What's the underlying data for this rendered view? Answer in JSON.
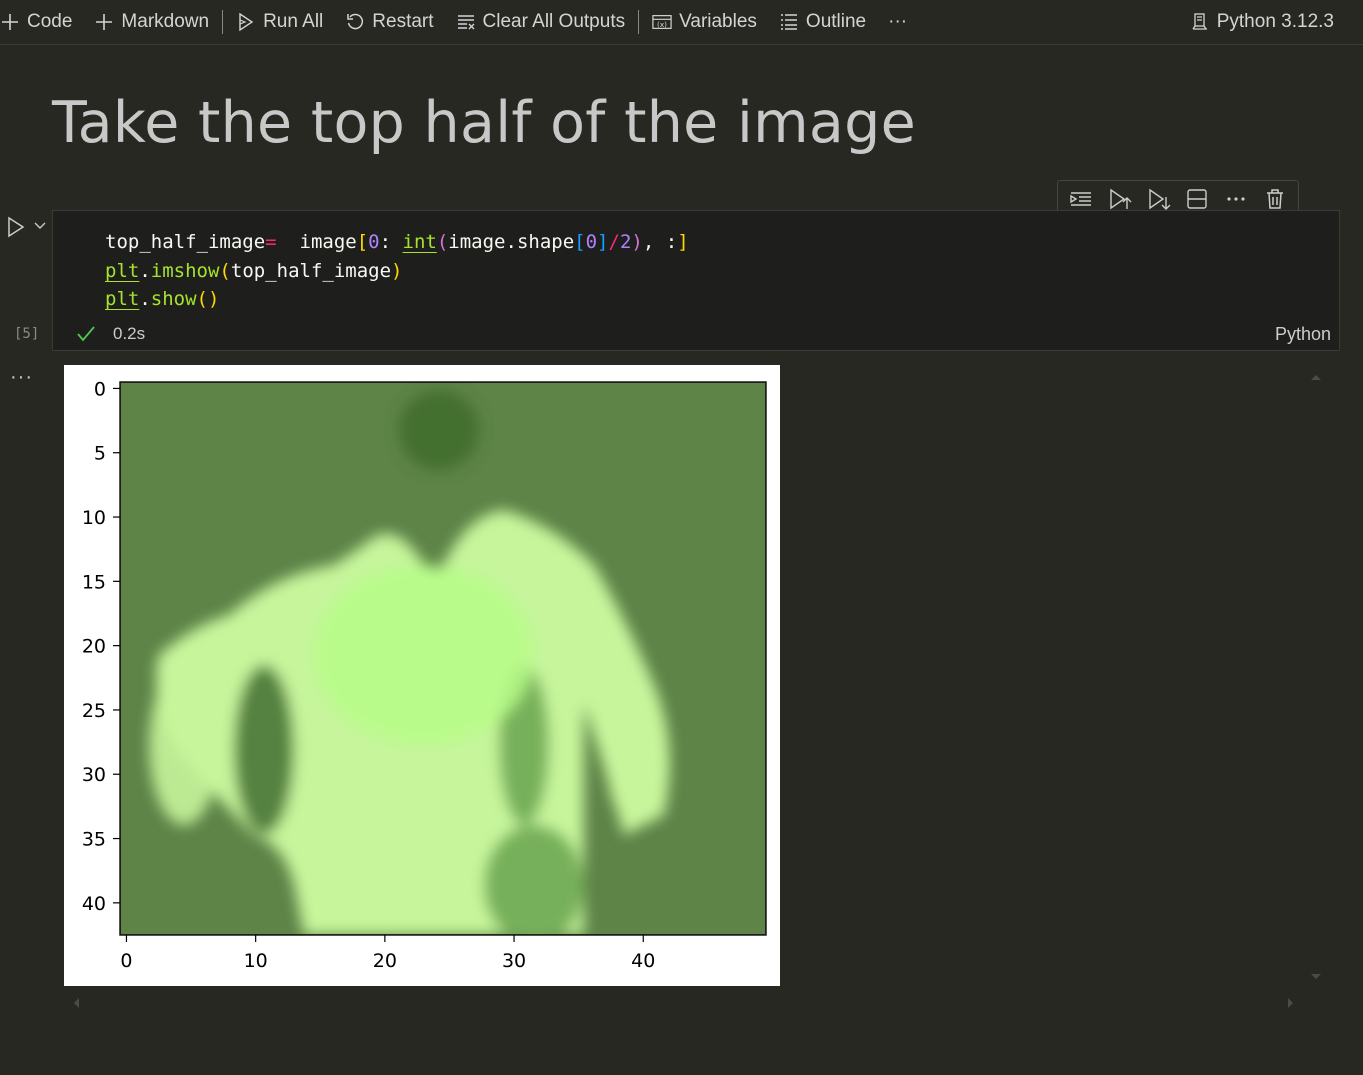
{
  "toolbar": {
    "code_label": "Code",
    "markdown_label": "Markdown",
    "run_all_label": "Run All",
    "restart_label": "Restart",
    "clear_outputs_label": "Clear All Outputs",
    "variables_label": "Variables",
    "outline_label": "Outline",
    "more_label": "···",
    "kernel_label": "Python 3.12.3"
  },
  "markdown": {
    "title": "Take the top half of the image"
  },
  "cell_toolbar": {
    "icons": [
      "execute-above-icon",
      "run-above-icon",
      "run-below-icon",
      "split-cell-icon",
      "more-icon",
      "trash-icon"
    ]
  },
  "code_cell": {
    "exec_count": "[5]",
    "duration": "0.2s",
    "language": "Python",
    "lines": [
      "top_half_image=  image[0: int(image.shape[0]/2), :]",
      "plt.imshow(top_half_image)",
      "plt.show()"
    ]
  },
  "output": {
    "more_label": "···",
    "chart_data": {
      "type": "heatmap",
      "x_ticks": [
        "0",
        "10",
        "20",
        "30",
        "40"
      ],
      "y_ticks": [
        "0",
        "5",
        "10",
        "15",
        "20",
        "25",
        "30",
        "35",
        "40"
      ],
      "xlim": [
        -0.5,
        49.5
      ],
      "ylim": [
        42.5,
        -0.5
      ],
      "colors": {
        "background": "#5e8448",
        "dark": "#416d2f",
        "mid": "#6ea853",
        "light": "#c6f59b",
        "bright": "#b6fb88"
      }
    }
  },
  "colors": {
    "background": "#272822",
    "cell_background": "#1e1f1c",
    "success": "#4ec94e"
  }
}
